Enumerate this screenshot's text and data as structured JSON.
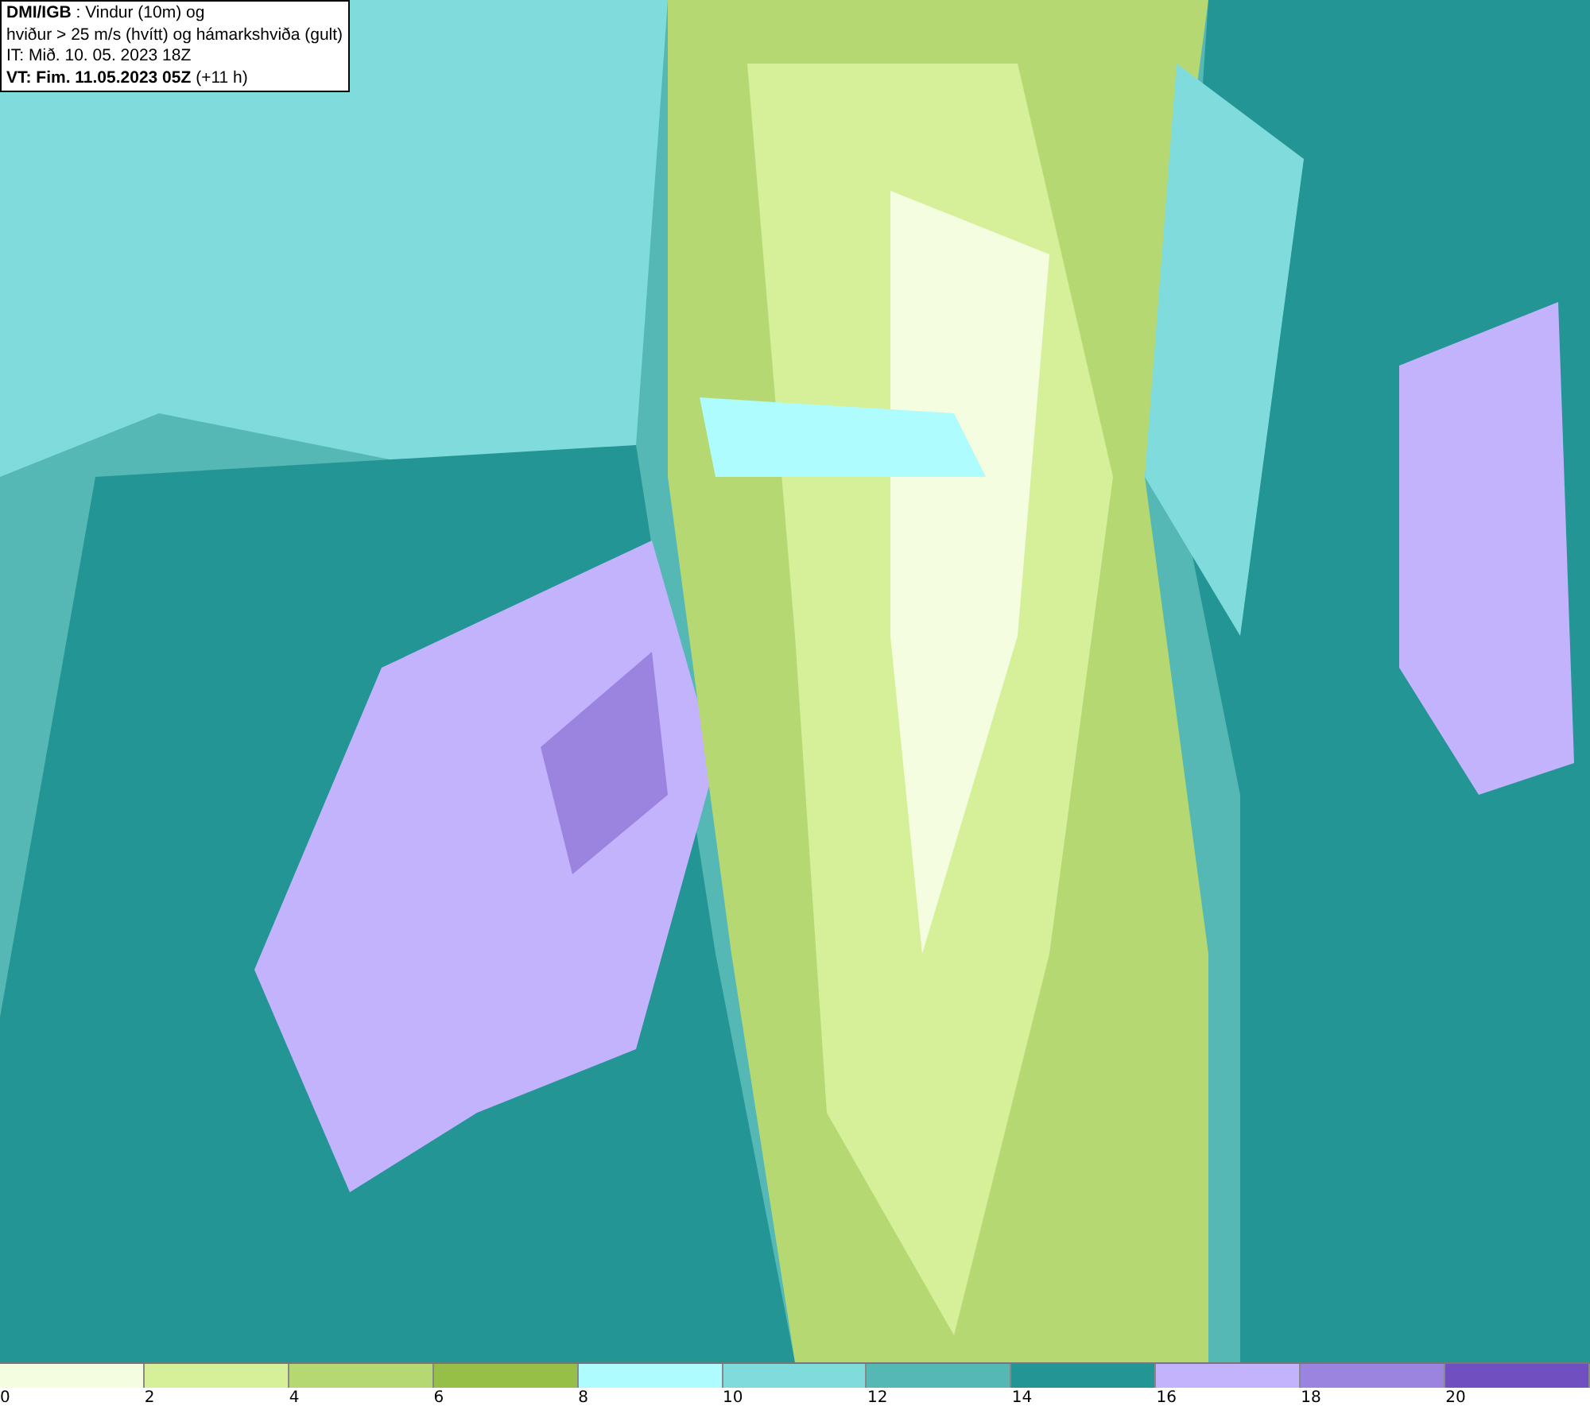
{
  "header": {
    "lines": [
      "**DMI/IGB** : Vindur (10m) og",
      "hviður > 25 m/s (hvítt) og hámarkshviða (gult)",
      "IT: Mið. 10. 05. 2023 18Z",
      "**VT: Fim. 11.05.2023 05Z** (+11 h)"
    ]
  },
  "legend": {
    "bins": [
      {
        "color": "#f5fde0"
      },
      {
        "color": "#d6f09a"
      },
      {
        "color": "#b5d873"
      },
      {
        "color": "#96bf48"
      },
      {
        "color": "#aefcfd"
      },
      {
        "color": "#80dcdc"
      },
      {
        "color": "#55b8b4"
      },
      {
        "color": "#239594"
      },
      {
        "color": "#c3b3fc"
      },
      {
        "color": "#9a84e0"
      },
      {
        "color": "#7050c0"
      }
    ],
    "ticks": [
      "0",
      "2",
      "4",
      "6",
      "8",
      "10",
      "12",
      "14",
      "16",
      "18",
      "20"
    ]
  }
}
